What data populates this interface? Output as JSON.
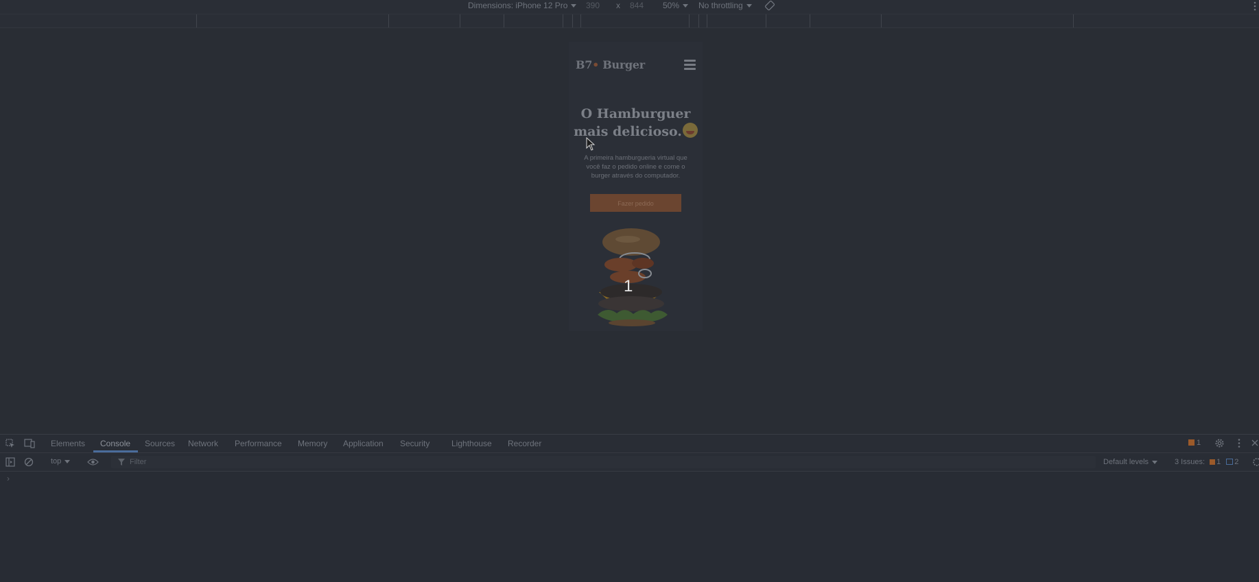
{
  "device_toolbar": {
    "dimensions_label": "Dimensions: iPhone 12 Pro",
    "width": "390",
    "times": "x",
    "height": "844",
    "zoom": "50%",
    "throttling": "No throttling"
  },
  "page": {
    "logo_part1": "B7",
    "logo_dot": "•",
    "logo_part2": "Burger",
    "hero_title_line1": "O Hamburguer",
    "hero_title_line2": "mais delicioso.",
    "hero_description": "A primeira hamburgueria virtual que você faz o pedido online e come o burger através do computador.",
    "cta_label": "Fazer pedido",
    "image_overlay_number": "1"
  },
  "devtools": {
    "tabs": [
      {
        "label": "Elements"
      },
      {
        "label": "Console",
        "active": true
      },
      {
        "label": "Sources"
      },
      {
        "label": "Network"
      },
      {
        "label": "Performance"
      },
      {
        "label": "Memory"
      },
      {
        "label": "Application"
      },
      {
        "label": "Security"
      },
      {
        "label": "Lighthouse"
      },
      {
        "label": "Recorder"
      }
    ],
    "warning_count": "1",
    "context": "top",
    "filter_placeholder": "Filter",
    "levels": "Default levels",
    "issues_label": "3 Issues:",
    "issues_warnings": "1",
    "issues_info": "2",
    "prompt_symbol": "›"
  },
  "colors": {
    "background": "#282c34",
    "accent_orange": "#6b4530",
    "active_tab_underline": "#4a6d9c"
  }
}
